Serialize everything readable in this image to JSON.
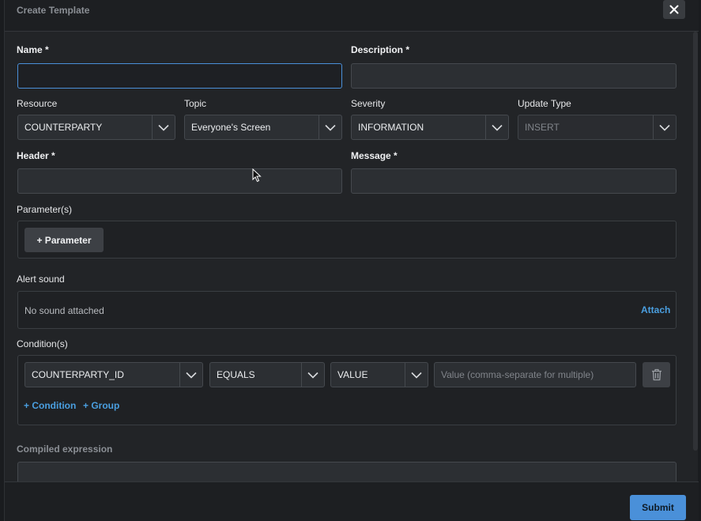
{
  "dialog": {
    "title": "Create Template",
    "close_icon": "close-icon"
  },
  "fields": {
    "name_label": "Name *",
    "description_label": "Description *",
    "resource_label": "Resource",
    "resource_value": "COUNTERPARTY",
    "topic_label": "Topic",
    "topic_value": "Everyone's Screen",
    "severity_label": "Severity",
    "severity_value": "INFORMATION",
    "update_type_label": "Update Type",
    "update_type_value": "INSERT",
    "header_label": "Header *",
    "message_label": "Message *"
  },
  "parameters": {
    "label": "Parameter(s)",
    "add_button": "+ Parameter"
  },
  "alert_sound": {
    "label": "Alert sound",
    "status": "No sound attached",
    "attach_link": "Attach"
  },
  "conditions": {
    "label": "Condition(s)",
    "field_value": "COUNTERPARTY_ID",
    "operator_value": "EQUALS",
    "type_value": "VALUE",
    "value_placeholder": "Value (comma-separate for multiple)",
    "add_condition": "+ Condition",
    "add_group": "+ Group"
  },
  "compiled": {
    "label": "Compiled expression"
  },
  "footer": {
    "submit_label": "Submit"
  },
  "colors": {
    "accent": "#4a90d9",
    "link": "#4a9fe0",
    "background": "#222427"
  }
}
